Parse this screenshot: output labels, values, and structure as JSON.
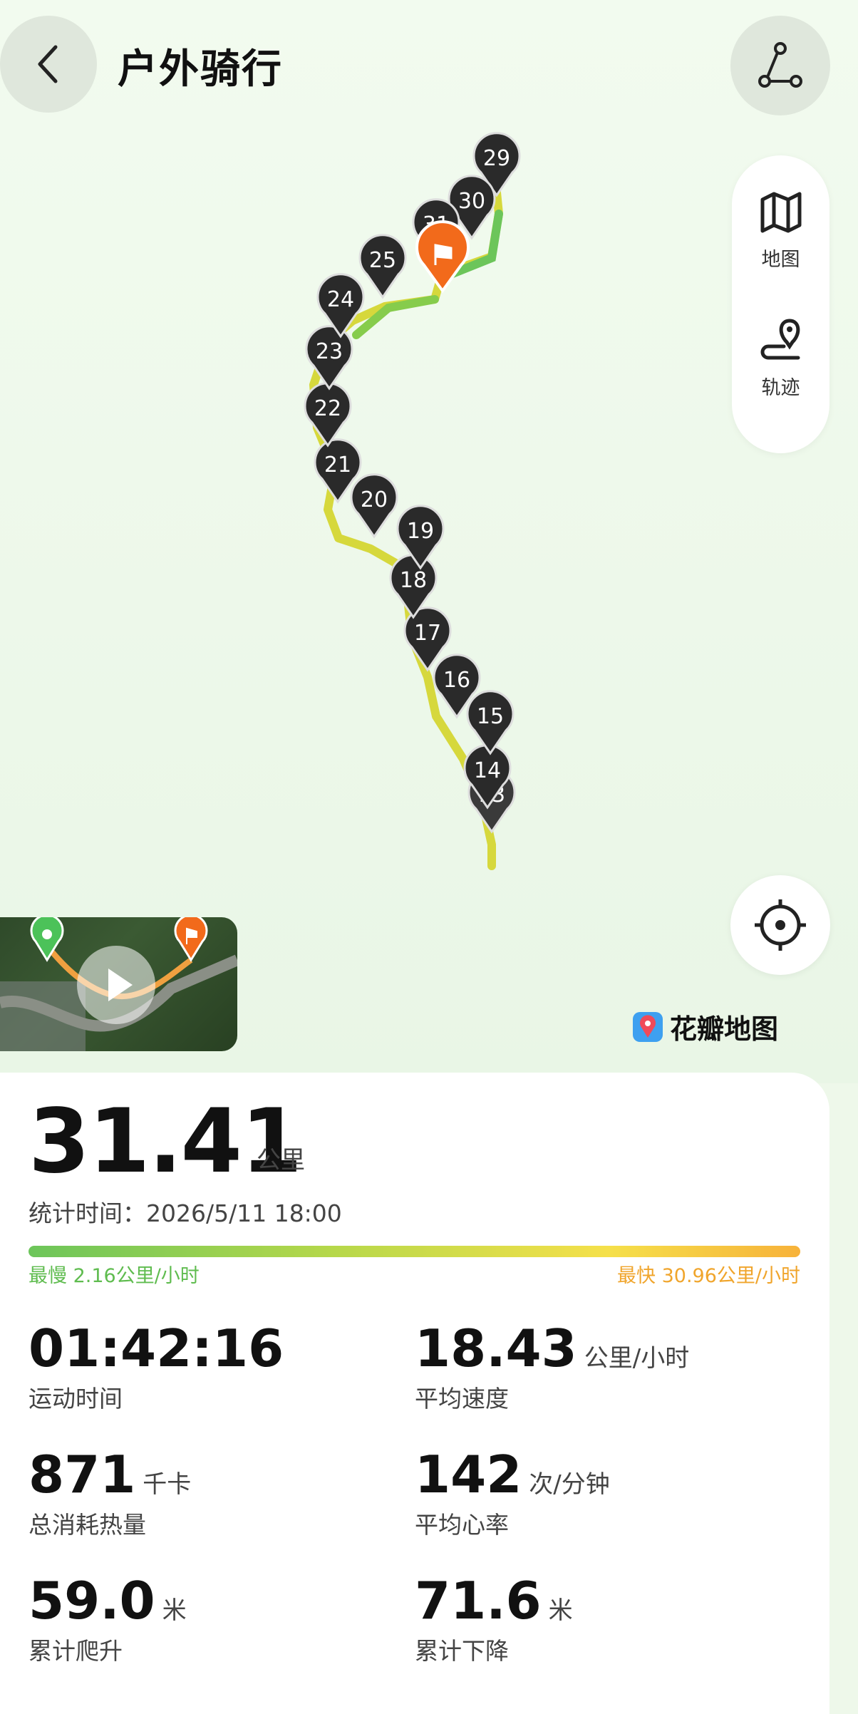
{
  "header": {
    "title": "户外骑行"
  },
  "side_panel": {
    "map_label": "地图",
    "track_label": "轨迹"
  },
  "brand": {
    "name": "花瓣地图"
  },
  "summary": {
    "distance": "31.41",
    "distance_unit": "公里",
    "stat_time": "统计时间：2026/5/11 18:00",
    "slowest": "最慢 2.16公里/小时",
    "fastest": "最快 30.96公里/小时"
  },
  "metrics": [
    {
      "value": "01:42:16",
      "unit": "",
      "label": "运动时间"
    },
    {
      "value": "18.43",
      "unit": "公里/小时",
      "label": "平均速度"
    },
    {
      "value": "871",
      "unit": "千卡",
      "label": "总消耗热量"
    },
    {
      "value": "142",
      "unit": "次/分钟",
      "label": "平均心率"
    },
    {
      "value": "59.0",
      "unit": "米",
      "label": "累计爬升"
    },
    {
      "value": "71.6",
      "unit": "米",
      "label": "累计下降"
    }
  ],
  "km_markers": [
    "13",
    "14",
    "15",
    "16",
    "17",
    "18",
    "19",
    "20",
    "21",
    "22",
    "23",
    "24",
    "25",
    "29",
    "30",
    "31"
  ],
  "colors": {
    "slow": "#5fbc4f",
    "fast": "#f0a52c",
    "end_flag": "#f26a1b",
    "start_pin": "#4cc259"
  }
}
